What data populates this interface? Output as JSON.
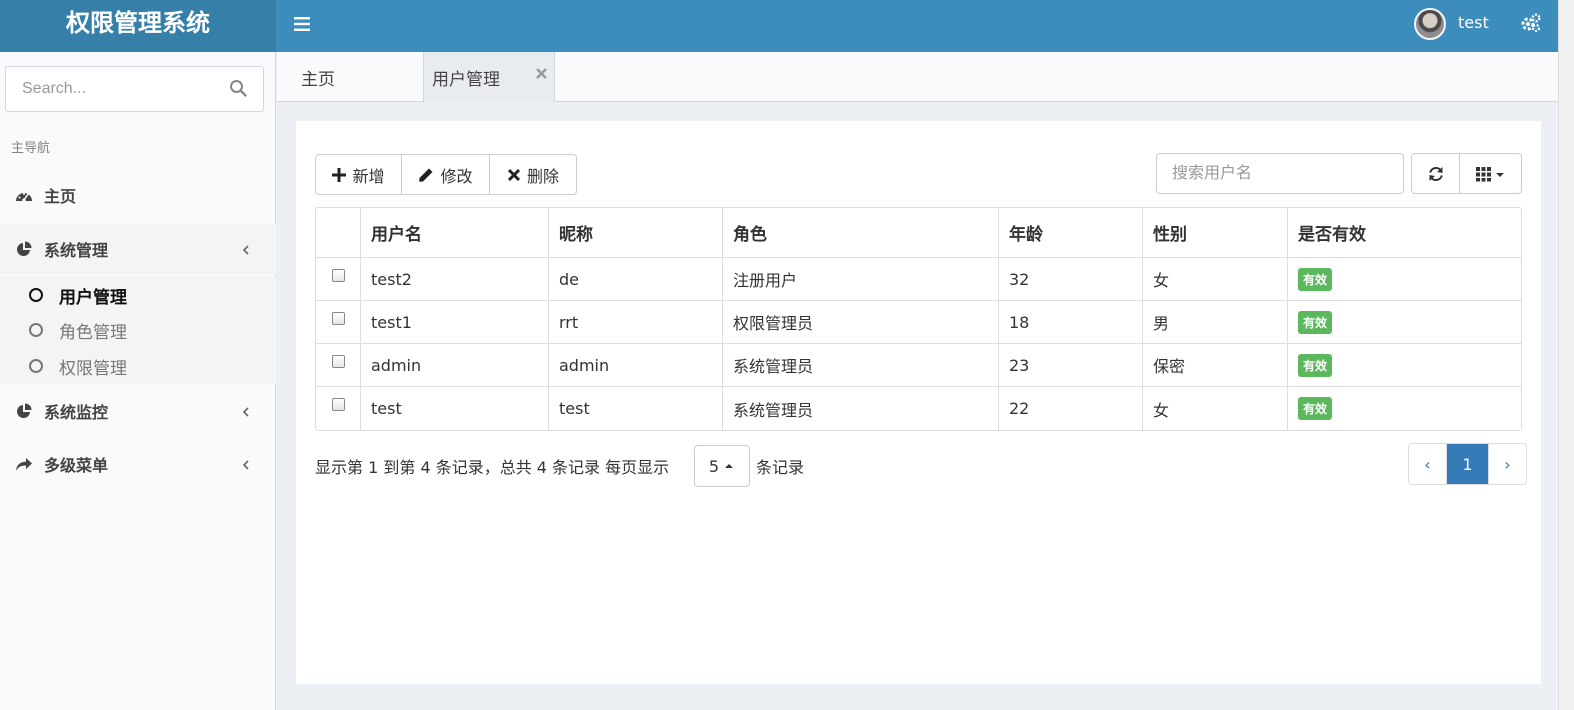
{
  "header": {
    "logo": "权限管理系统",
    "user_name": "test"
  },
  "sidebar": {
    "search_placeholder": "Search...",
    "nav_header": "主导航",
    "items": [
      {
        "label": "主页",
        "icon": "dashboard-icon"
      },
      {
        "label": "系统管理",
        "icon": "pie-chart-icon"
      },
      {
        "label": "系统监控",
        "icon": "pie-chart-icon"
      },
      {
        "label": "多级菜单",
        "icon": "share-icon"
      }
    ],
    "submenu": [
      {
        "label": "用户管理",
        "current": true
      },
      {
        "label": "角色管理",
        "current": false
      },
      {
        "label": "权限管理",
        "current": false
      }
    ]
  },
  "tabs": [
    {
      "label": "主页"
    },
    {
      "label": "用户管理"
    }
  ],
  "toolbar": {
    "add": "新增",
    "edit": "修改",
    "delete": "删除",
    "search_placeholder": "搜索用户名"
  },
  "table": {
    "columns": [
      "用户名",
      "昵称",
      "角色",
      "年龄",
      "性别",
      "是否有效"
    ],
    "rows": [
      {
        "username": "test2",
        "nickname": "de",
        "role": "注册用户",
        "age": "32",
        "gender": "女",
        "status": "有效"
      },
      {
        "username": "test1",
        "nickname": "rrt",
        "role": "权限管理员",
        "age": "18",
        "gender": "男",
        "status": "有效"
      },
      {
        "username": "admin",
        "nickname": "admin",
        "role": "系统管理员",
        "age": "23",
        "gender": "保密",
        "status": "有效"
      },
      {
        "username": "test",
        "nickname": "test",
        "role": "系统管理员",
        "age": "22",
        "gender": "女",
        "status": "有效"
      }
    ]
  },
  "pagination": {
    "info": "显示第 1 到第 4 条记录，总共 4 条记录 每页显示",
    "page_size": "5",
    "tail": "条记录",
    "prev": "‹",
    "current_page": "1",
    "next": "›"
  },
  "colors": {
    "header": "#3c8dbc",
    "logo_bg": "#367fa9",
    "badge": "#5cb85c",
    "pager_active": "#337ab7"
  }
}
